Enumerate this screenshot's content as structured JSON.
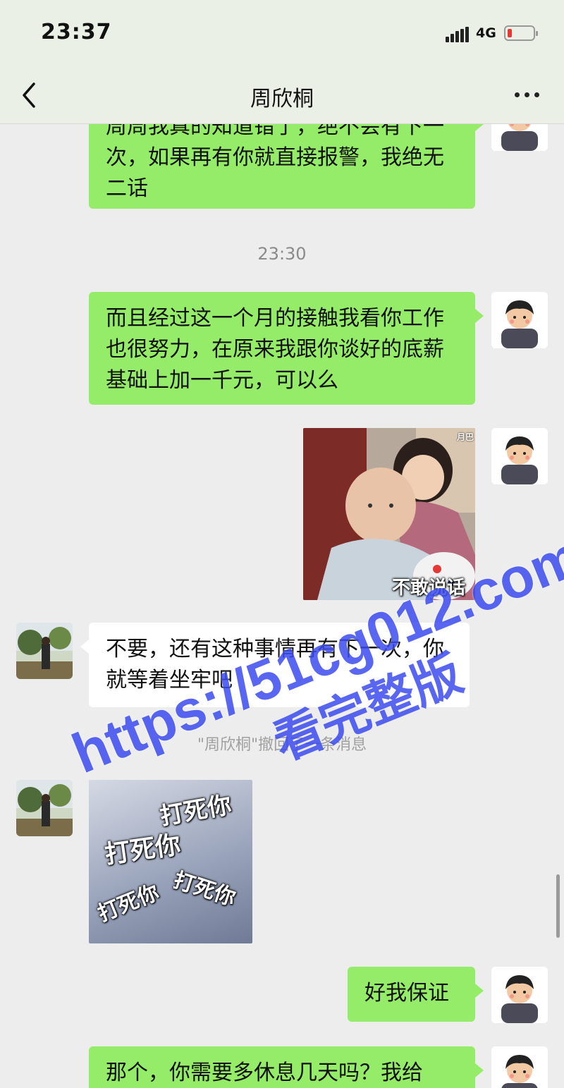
{
  "status_bar": {
    "time": "23:37",
    "network": "4G"
  },
  "header": {
    "title": "周欣桐"
  },
  "messages": [
    {
      "type": "text",
      "side": "right",
      "text": "周周我真的知道错了，绝不会有下一次，如果再有你就直接报警，我绝无二话"
    },
    {
      "type": "timestamp",
      "text": "23:30"
    },
    {
      "type": "text",
      "side": "right",
      "text": "而且经过这一个月的接触我看你工作也很努力，在原来我跟你谈好的底薪基础上加一千元，可以么"
    },
    {
      "type": "sticker",
      "side": "right",
      "caption": "不敢说话",
      "tag": "月巴"
    },
    {
      "type": "text",
      "side": "left",
      "text": "不要，还有这种事情再有下一次，你就等着坐牢吧"
    },
    {
      "type": "system",
      "text": "\"周欣桐\"撤回了一条消息"
    },
    {
      "type": "sticker",
      "side": "left",
      "caption_lines": [
        "打死你",
        "打死你",
        "打死你",
        "打死你"
      ]
    },
    {
      "type": "text",
      "side": "right",
      "text": "好我保证"
    },
    {
      "type": "text",
      "side": "right",
      "text": "那个，你需要多休息几天吗？我给"
    }
  ],
  "watermark": {
    "url": "https://51cg012.com",
    "subtitle": "看完整版"
  },
  "colors": {
    "bubble_out": "#95ec69",
    "bubble_in": "#ffffff",
    "background": "#ededed",
    "watermark": "#3b4cf0"
  }
}
